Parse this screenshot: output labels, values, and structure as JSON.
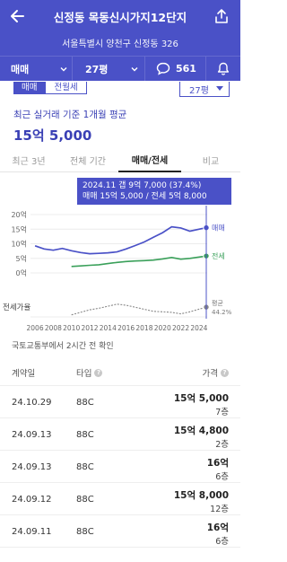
{
  "header": {
    "title": "신정동 목동신시가지12단지",
    "address": "서울특별시 양천구 신정동 326",
    "deal_type": "매매",
    "size": "27평",
    "comment_count": "561"
  },
  "trade_toggle": {
    "active": "매매",
    "inactive": "전월세"
  },
  "size_pill": "27평",
  "summary": {
    "label": "최근 실거래 기준 1개월 평균",
    "price": "15억 5,000"
  },
  "tabs": [
    "최근 3년",
    "전체 기간",
    "매매/전세",
    "비교"
  ],
  "tooltip": {
    "line1": "2024.11  갭 9억 7,000 (37.4%)",
    "line2": "매매 15억 5,000 / 전세 5억 8,000"
  },
  "chart_data": {
    "type": "line",
    "x": [
      2006,
      2007,
      2008,
      2009,
      2010,
      2011,
      2012,
      2013,
      2014,
      2015,
      2016,
      2017,
      2018,
      2019,
      2020,
      2021,
      2022,
      2023,
      2024.8
    ],
    "x_tick_labels": [
      "2006",
      "2008",
      "2010",
      "2012",
      "2014",
      "2016",
      "2018",
      "2020",
      "2022",
      "2024"
    ],
    "y_tick_labels": [
      "20억",
      "15억",
      "10억",
      "5억",
      "0억"
    ],
    "ylim": [
      0,
      20
    ],
    "series": [
      {
        "name": "매매",
        "color": "#4a51c7",
        "values": [
          9.3,
          8.2,
          7.8,
          8.4,
          7.6,
          7.0,
          6.6,
          6.7,
          6.9,
          7.2,
          8.2,
          9.4,
          10.6,
          12.2,
          13.8,
          15.8,
          15.4,
          14.3,
          15.5
        ]
      },
      {
        "name": "전세",
        "color": "#3aa05a",
        "values": [
          null,
          null,
          null,
          null,
          2.2,
          2.4,
          2.6,
          2.8,
          3.2,
          3.6,
          3.9,
          4.1,
          4.2,
          4.4,
          4.8,
          5.3,
          4.7,
          5.0,
          5.8
        ]
      },
      {
        "name": "전세가율",
        "color": "#888888",
        "values": [
          null,
          null,
          null,
          null,
          29,
          34,
          39,
          42,
          46,
          50,
          48,
          44,
          40,
          36,
          35,
          34,
          31,
          35,
          44.2
        ]
      }
    ],
    "ratio_label": "전세가율",
    "ratio_end_label": "평균",
    "ratio_end_value": "44.2%"
  },
  "source_note": "국토교통부에서 2시간 전 확인",
  "table": {
    "headers": {
      "date": "계약일",
      "type": "타입",
      "price": "가격"
    },
    "rows": [
      {
        "date": "24.10.29",
        "type": "88C",
        "price": "15억 5,000",
        "floor": "7층"
      },
      {
        "date": "24.09.13",
        "type": "88C",
        "price": "15억 4,800",
        "floor": "2층"
      },
      {
        "date": "24.09.13",
        "type": "88C",
        "price": "16억",
        "floor": "6층"
      },
      {
        "date": "24.09.12",
        "type": "88C",
        "price": "15억 8,000",
        "floor": "12층"
      },
      {
        "date": "24.09.11",
        "type": "88C",
        "price": "16억",
        "floor": "6층"
      }
    ]
  }
}
